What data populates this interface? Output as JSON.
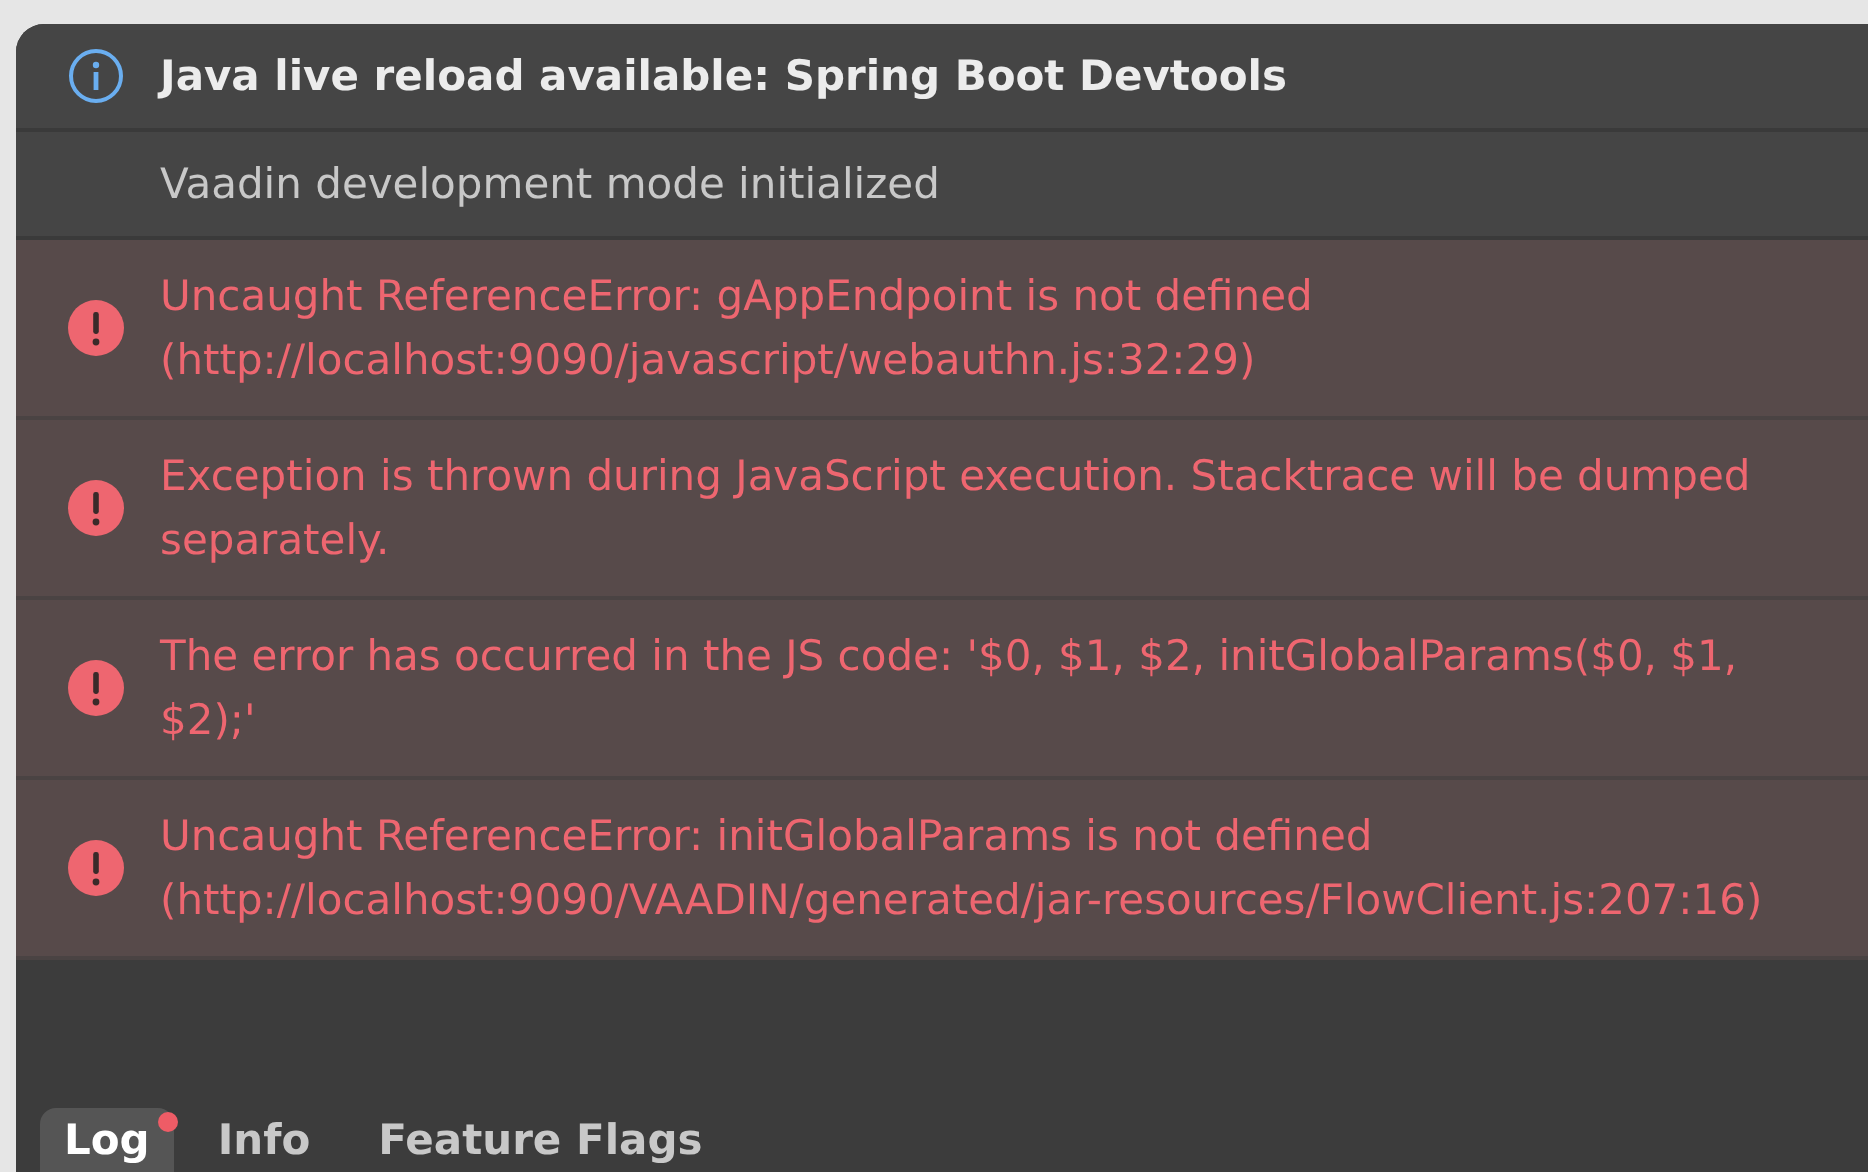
{
  "messages": [
    {
      "kind": "info",
      "text": "Java live reload available: Spring Boot Devtools"
    },
    {
      "kind": "plain",
      "text": "Vaadin development mode initialized"
    },
    {
      "kind": "error",
      "text": "Uncaught ReferenceError: gAppEndpoint is not defined (http://localhost:9090/javascript/webauthn.js:32:29)"
    },
    {
      "kind": "error",
      "text": "Exception is thrown during JavaScript execution. Stacktrace will be dumped separately."
    },
    {
      "kind": "error",
      "text": "The error has occurred in the JS code: '$0, $1, $2, initGlobalParams($0, $1, $2);'"
    },
    {
      "kind": "error",
      "text": "Uncaught ReferenceError: initGlobalParams is not defined (http://localhost:9090/VAADIN/generated/jar-resources/FlowClient.js:207:16)"
    }
  ],
  "tabs": [
    {
      "label": "Log",
      "selected": true,
      "unread": true
    },
    {
      "label": "Info",
      "selected": false,
      "unread": false
    },
    {
      "label": "Feature Flags",
      "selected": false,
      "unread": false
    }
  ]
}
